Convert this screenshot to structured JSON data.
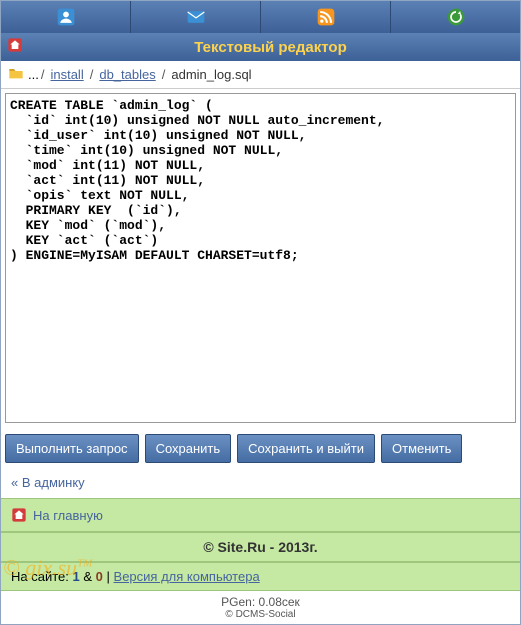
{
  "nav_icons": [
    "user-icon",
    "mail-icon",
    "rss-icon",
    "refresh-icon"
  ],
  "title": "Текстовый редактор",
  "breadcrumb": {
    "root": "...",
    "parts": [
      "install",
      "db_tables"
    ],
    "current": "admin_log.sql"
  },
  "editor_content": "CREATE TABLE `admin_log` (\n  `id` int(10) unsigned NOT NULL auto_increment,\n  `id_user` int(10) unsigned NOT NULL,\n  `time` int(10) unsigned NOT NULL,\n  `mod` int(11) NOT NULL,\n  `act` int(11) NOT NULL,\n  `opis` text NOT NULL,\n  PRIMARY KEY  (`id`),\n  KEY `mod` (`mod`),\n  KEY `act` (`act`)\n) ENGINE=MyISAM DEFAULT CHARSET=utf8;",
  "buttons": {
    "execute": "Выполнить запрос",
    "save": "Сохранить",
    "save_exit": "Сохранить и выйти",
    "cancel": "Отменить"
  },
  "links": {
    "to_admin": "В админку",
    "to_home": "На главную"
  },
  "copyright": "© Site.Ru - 2013г.",
  "status": {
    "prefix": "На сайте:",
    "count1": "1",
    "amp": "&",
    "count0": "0",
    "sep": "|",
    "version_link": "Версия для компьютера"
  },
  "footer": {
    "pgen": "PGen: 0.08сек",
    "dcms": "© DCMS-Social"
  },
  "watermark": "© gix.su™"
}
